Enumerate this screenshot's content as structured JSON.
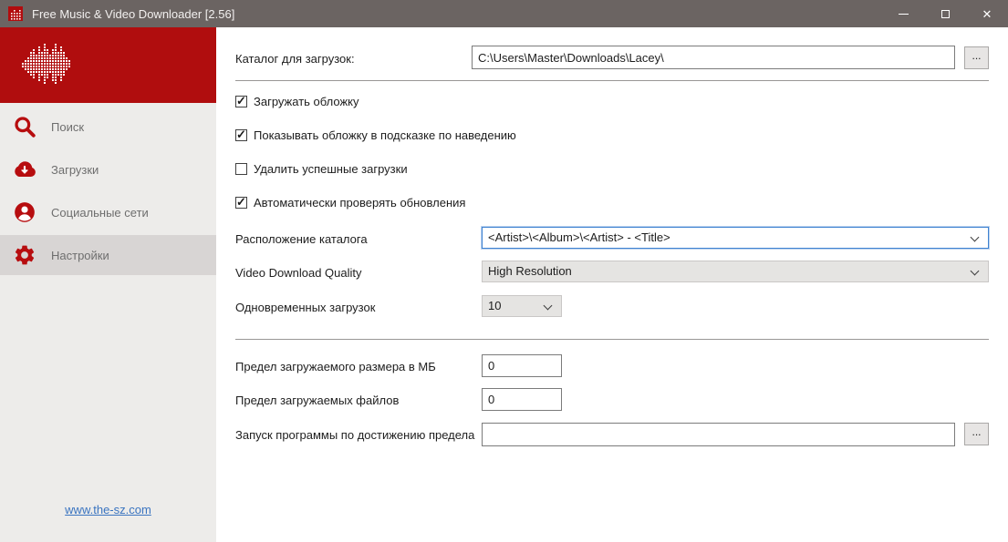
{
  "window": {
    "title": "Free Music & Video Downloader [2.56]"
  },
  "icons": {
    "check_glyph": "✓",
    "close_glyph": "✕"
  },
  "sidebar": {
    "items": [
      {
        "label": "Поиск",
        "icon": "search",
        "selected": false
      },
      {
        "label": "Загрузки",
        "icon": "cloud-download",
        "selected": false
      },
      {
        "label": "Социальные сети",
        "icon": "user",
        "selected": false
      },
      {
        "label": "Настройки",
        "icon": "gear",
        "selected": true
      }
    ],
    "link": "www.the-sz.com"
  },
  "settings": {
    "download_folder": {
      "label": "Каталог для загрузок:",
      "value": "C:\\Users\\Master\\Downloads\\Lacey\\",
      "browse_label": "..."
    },
    "checkboxes": [
      {
        "label": "Загружать обложку",
        "checked": true
      },
      {
        "label": "Показывать обложку в подсказке по наведению",
        "checked": true
      },
      {
        "label": "Удалить успешные загрузки",
        "checked": false
      },
      {
        "label": "Автоматически проверять обновления",
        "checked": true
      }
    ],
    "folder_layout": {
      "label": "Расположение каталога",
      "value": "<Artist>\\<Album>\\<Artist> - <Title>"
    },
    "video_quality": {
      "label": "Video Download Quality",
      "value": "High Resolution"
    },
    "concurrent_downloads": {
      "label": "Одновременных загрузок",
      "value": "10"
    },
    "size_limit_mb": {
      "label": "Предел загружаемого размера в МБ",
      "value": "0"
    },
    "files_limit": {
      "label": "Предел загружаемых файлов",
      "value": "0"
    },
    "run_program_on_limit": {
      "label": "Запуск программы по достижению предела",
      "value": "",
      "browse_label": "..."
    }
  },
  "colors": {
    "accent_red": "#b20d0f",
    "titlebar": "#6b6462",
    "sidebar_bg": "#edecea",
    "sidebar_selected": "#d8d5d4",
    "link_blue": "#3a74c0",
    "focus_border": "#3f82d1"
  }
}
